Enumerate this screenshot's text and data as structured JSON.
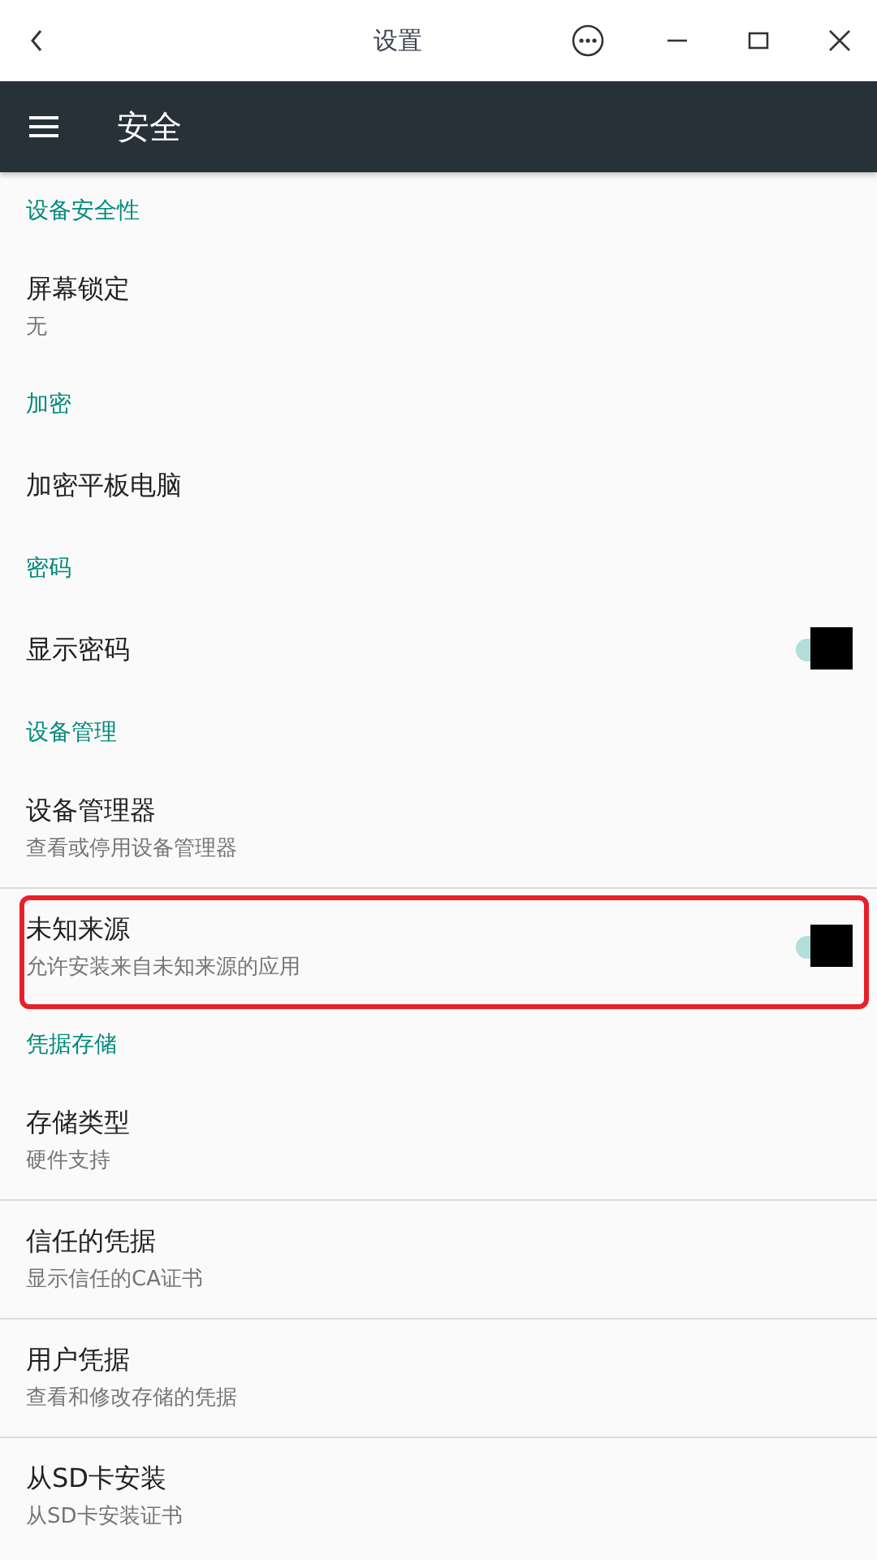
{
  "window": {
    "title": "设置"
  },
  "toolbar": {
    "title": "安全"
  },
  "sections": [
    {
      "header": "设备安全性",
      "items": [
        {
          "kind": "text",
          "title": "屏幕锁定",
          "summary": "无"
        }
      ]
    },
    {
      "header": "加密",
      "items": [
        {
          "kind": "text",
          "title": "加密平板电脑"
        }
      ]
    },
    {
      "header": "密码",
      "items": [
        {
          "kind": "switch",
          "title": "显示密码",
          "checked": true
        }
      ]
    },
    {
      "header": "设备管理",
      "items": [
        {
          "kind": "text",
          "title": "设备管理器",
          "summary": "查看或停用设备管理器"
        },
        {
          "kind": "switch",
          "title": "未知来源",
          "summary": "允许安装来自未知来源的应用",
          "checked": true,
          "highlighted": true
        }
      ]
    },
    {
      "header": "凭据存储",
      "items": [
        {
          "kind": "text",
          "title": "存储类型",
          "summary": "硬件支持"
        },
        {
          "kind": "text",
          "title": "信任的凭据",
          "summary": "显示信任的CA证书"
        },
        {
          "kind": "text",
          "title": "用户凭据",
          "summary": "查看和修改存储的凭据"
        },
        {
          "kind": "text",
          "title": "从SD卡安装",
          "summary": "从SD卡安装证书"
        }
      ]
    }
  ]
}
